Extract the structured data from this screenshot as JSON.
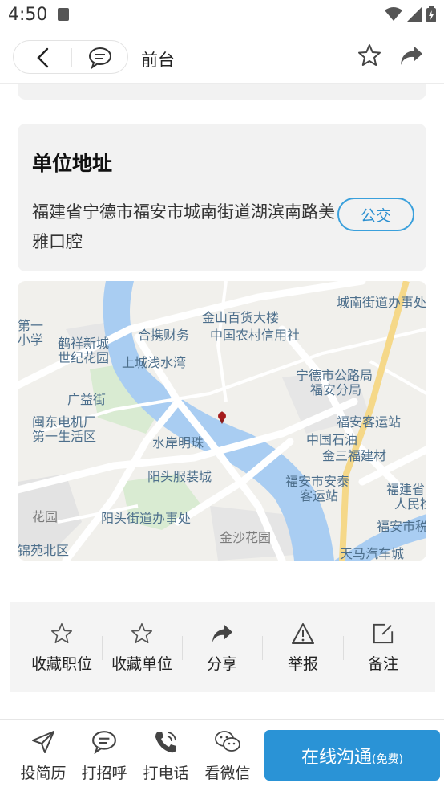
{
  "status_bar": {
    "time": "4:50"
  },
  "header": {
    "title": "前台"
  },
  "address": {
    "title": "单位地址",
    "text": "福建省宁德市福安市城南街道湖滨南路美雅口腔",
    "bus_button": "公交"
  },
  "map": {
    "labels": [
      "金山百货大楼",
      "中国农村信用社",
      "合携财务",
      "城南街道办事处",
      "第一",
      "小学",
      "鹤祥新城",
      "世纪花园",
      "上城浅水湾",
      "宁德市公路局",
      "福安分局",
      "广益街",
      "闽东电机厂",
      "第一生活区",
      "福安客运站",
      "中国石油",
      "金三福建材",
      "水岸明珠",
      "阳头服装城",
      "福安市安泰",
      "客运站",
      "福建省",
      "人民检",
      "福安市税",
      "花园",
      "阳头街道办事处",
      "金沙花园",
      "锦苑北区",
      "天马汽车城"
    ]
  },
  "actions": [
    {
      "label": "收藏职位",
      "icon": "star-icon"
    },
    {
      "label": "收藏单位",
      "icon": "star-icon"
    },
    {
      "label": "分享",
      "icon": "share-icon"
    },
    {
      "label": "举报",
      "icon": "warning-icon"
    },
    {
      "label": "备注",
      "icon": "edit-icon"
    }
  ],
  "bottom_bar": {
    "items": [
      {
        "label": "投简历",
        "icon": "send-icon"
      },
      {
        "label": "打招呼",
        "icon": "chat-icon"
      },
      {
        "label": "打电话",
        "icon": "phone-icon"
      },
      {
        "label": "看微信",
        "icon": "wechat-icon"
      }
    ],
    "cta": {
      "main": "在线沟通",
      "sub": "(免费)"
    }
  },
  "colors": {
    "accent": "#2a93d6",
    "card_bg": "#f2f2f2",
    "river": "#a9cdf2",
    "road_yellow": "#f5d889"
  }
}
